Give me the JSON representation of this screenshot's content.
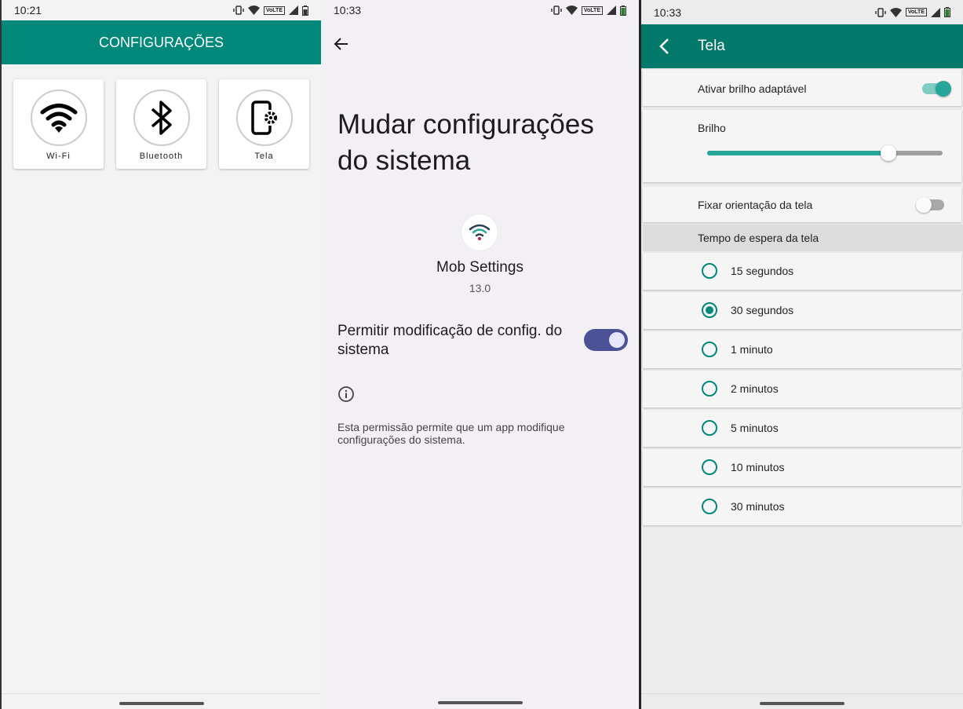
{
  "screen1": {
    "status": {
      "time": "10:21"
    },
    "header": {
      "title": "CONFIGURAÇÕES"
    },
    "tiles": [
      {
        "label": "Wi-Fi",
        "icon": "wifi-icon"
      },
      {
        "label": "Bluetooth",
        "icon": "bluetooth-icon"
      },
      {
        "label": "Tela",
        "icon": "screen-settings-icon"
      }
    ]
  },
  "screen2": {
    "status": {
      "time": "10:33"
    },
    "title": "Mudar configurações do sistema",
    "app": {
      "name": "Mob Settings",
      "version": "13.0"
    },
    "permission": {
      "label": "Permitir modificação de config. do sistema",
      "enabled": true
    },
    "info": "Esta permissão permite que um app modifique configurações do sistema.",
    "accent": "#4a5295"
  },
  "screen3": {
    "status": {
      "time": "10:33"
    },
    "appbar": {
      "title": "Tela"
    },
    "adaptive": {
      "label": "Ativar brilho adaptável",
      "enabled": true
    },
    "brightness": {
      "label": "Brilho",
      "level": 0.77
    },
    "orientation": {
      "label": "Fixar orientação da tela",
      "enabled": false
    },
    "timeout": {
      "header": "Tempo de espera da tela",
      "options": [
        "15 segundos",
        "30 segundos",
        "1 minuto",
        "2 minutos",
        "5 minutos",
        "10 minutos",
        "30 minutos"
      ],
      "selected": "30 segundos"
    },
    "accent": "#00897b"
  }
}
